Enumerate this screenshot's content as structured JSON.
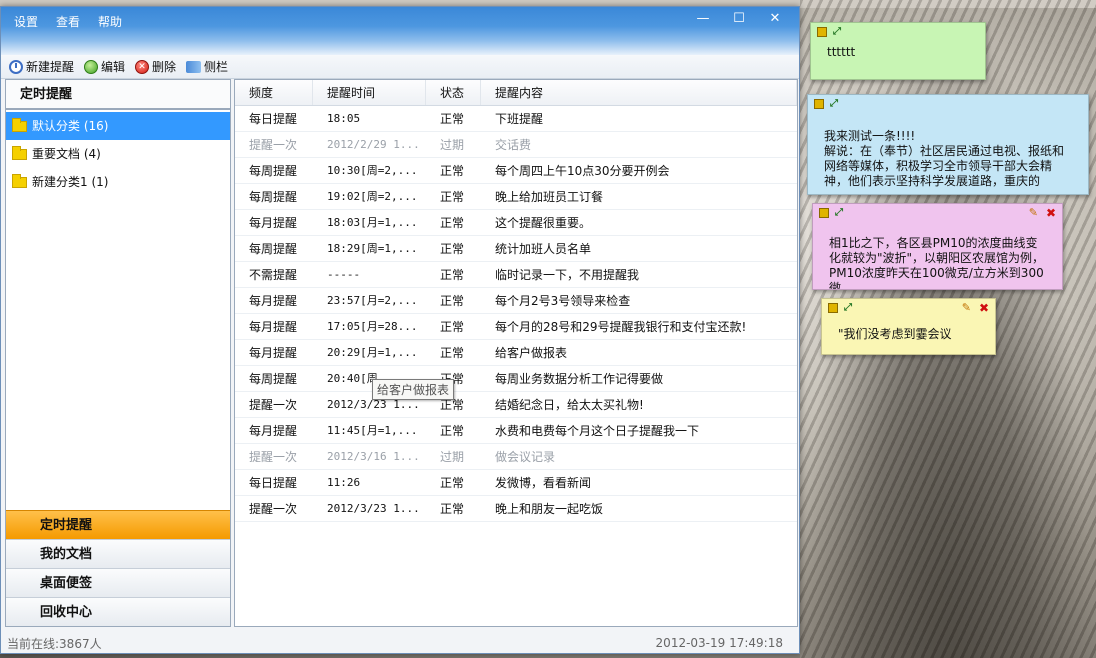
{
  "menu": [
    "设置",
    "查看",
    "帮助"
  ],
  "window_controls": {
    "minimize": "—",
    "maximize": "☐",
    "close": "✕"
  },
  "toolbar": {
    "new": "新建提醒",
    "edit": "编辑",
    "delete": "删除",
    "sidebar": "侧栏"
  },
  "left": {
    "header": "定时提醒",
    "categories": [
      "默认分类 (16)",
      "重要文档 (4)",
      "新建分类1 (1)"
    ],
    "nav": [
      "定时提醒",
      "我的文档",
      "桌面便签",
      "回收中心"
    ]
  },
  "table": {
    "headers": [
      "频度",
      "提醒时间",
      "状态",
      "提醒内容"
    ],
    "rows": [
      [
        "每日提醒",
        "18:05",
        "正常",
        "下班提醒"
      ],
      [
        "提醒一次",
        "2012/2/29 1...",
        "过期",
        "交话费"
      ],
      [
        "每周提醒",
        "10:30[周=2,...",
        "正常",
        "每个周四上午10点30分要开例会"
      ],
      [
        "每周提醒",
        "19:02[周=2,...",
        "正常",
        "晚上给加班员工订餐"
      ],
      [
        "每月提醒",
        "18:03[月=1,...",
        "正常",
        "这个提醒很重要。"
      ],
      [
        "每周提醒",
        "18:29[周=1,...",
        "正常",
        "统计加班人员名单"
      ],
      [
        "不需提醒",
        "-----",
        "正常",
        "临时记录一下，不用提醒我"
      ],
      [
        "每月提醒",
        "23:57[月=2,...",
        "正常",
        "每个月2号3号领导来检查"
      ],
      [
        "每月提醒",
        "17:05[月=28...",
        "正常",
        "每个月的28号和29号提醒我银行和支付宝还款!"
      ],
      [
        "每月提醒",
        "20:29[月=1,...",
        "正常",
        "给客户做报表"
      ],
      [
        "每周提醒",
        "20:40[周",
        "正常",
        "每周业务数据分析工作记得要做"
      ],
      [
        "提醒一次",
        "2012/3/23 1...",
        "正常",
        "结婚纪念日，给太太买礼物!"
      ],
      [
        "每月提醒",
        "11:45[月=1,...",
        "正常",
        "水费和电费每个月这个日子提醒我一下"
      ],
      [
        "提醒一次",
        "2012/3/16 1...",
        "过期",
        "做会议记录"
      ],
      [
        "每日提醒",
        "11:26",
        "正常",
        "发微博，看看新闻"
      ],
      [
        "提醒一次",
        "2012/3/23 1...",
        "正常",
        "晚上和朋友一起吃饭"
      ]
    ],
    "tooltip": "给客户做报表"
  },
  "status": {
    "online": "当前在线:3867人",
    "datetime": "2012-03-19 17:49:18"
  },
  "notes": [
    {
      "text": "tttttt",
      "color": "#c8f5b4"
    },
    {
      "text": "我来测试一条!!!!\n解说：在（奉节）社区居民通过电视、报纸和网络等媒体，积极学习全市领导干部大会精神，他们表示坚持科学发展道路，重庆的",
      "color": "#c4e6f6"
    },
    {
      "text": "相1比之下，各区县PM10的浓度曲线变化就较为\"波折\"，以朝阳区农展馆为例，PM10浓度昨天在100微克/立方米到300微",
      "color": "#f0c4ee"
    },
    {
      "text": "\"我们没考虑到霎会议",
      "color": "#faf6b4"
    }
  ]
}
